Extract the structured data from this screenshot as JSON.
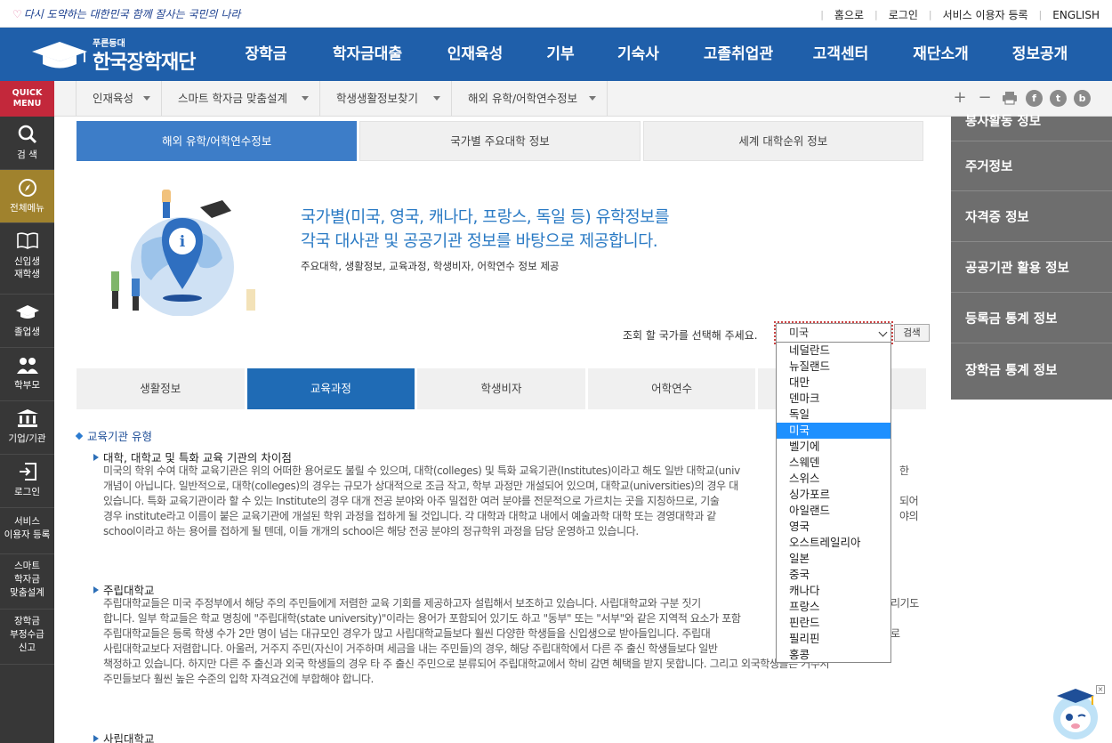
{
  "topbar": {
    "slogan": "다시 도약하는 대한민국 함께 잘사는 국민의 나라",
    "links": [
      "홈으로",
      "로그인",
      "서비스 이용자 등록",
      "ENGLISH"
    ]
  },
  "header": {
    "logo_small": "푸른등대",
    "logo_text": "한국장학재단",
    "nav": [
      "장학금",
      "학자금대출",
      "인재육성",
      "기부",
      "기숙사",
      "고졸취업관",
      "고객센터",
      "재단소개",
      "정보공개"
    ]
  },
  "quick": {
    "title_line1": "QUICK",
    "title_line2": "MENU",
    "items": [
      {
        "icon": "search-icon",
        "label1": "검 색",
        "label2": ""
      },
      {
        "icon": "compass-icon",
        "label1": "전체메뉴",
        "label2": ""
      },
      {
        "icon": "book-icon",
        "label1": "신입생",
        "label2": "재학생"
      },
      {
        "icon": "graduation-cap-icon",
        "label1": "졸업생",
        "label2": ""
      },
      {
        "icon": "parents-icon",
        "label1": "학부모",
        "label2": ""
      },
      {
        "icon": "building-icon",
        "label1": "기업/기관",
        "label2": ""
      },
      {
        "icon": "login-icon",
        "label1": "로그인",
        "label2": ""
      },
      {
        "icon": "",
        "label1": "서비스",
        "label2": "이용자 등록"
      },
      {
        "icon": "",
        "label1": "스마트",
        "label2": "학자금",
        "label3": "맞춤설계"
      },
      {
        "icon": "",
        "label1": "장학금",
        "label2": "부정수급",
        "label3": "신고"
      }
    ]
  },
  "subnav": {
    "items": [
      "인재육성",
      "스마트 학자금 맞춤설계",
      "학생생활정보찾기",
      "해외 유학/어학연수정보"
    ],
    "tools": {
      "zoom_in": "+",
      "zoom_out": "−",
      "facebook": "f",
      "twitter": "t",
      "blog": "b"
    }
  },
  "rside": {
    "items": [
      "봉사활동 정보",
      "주거정보",
      "자격증 정보",
      "공공기관 활용 정보",
      "등록금 통계 정보",
      "장학금 통계 정보"
    ]
  },
  "tabs1": [
    "해외 유학/어학연수정보",
    "국가별 주요대학 정보",
    "세계 대학순위 정보"
  ],
  "hero": {
    "line1": "국가별(미국, 영국, 캐나다, 프랑스, 독일 등) 유학정보를",
    "line2": "각국 대사관 및 공공기관 정보를 바탕으로 제공합니다.",
    "sub": "주요대학, 생활정보, 교육과정, 학생비자, 어학연수 정보 제공"
  },
  "country_select": {
    "label": "조회 할 국가를 선택해 주세요.",
    "selected": "미국",
    "button": "검색",
    "options": [
      "네덜란드",
      "뉴질랜드",
      "대만",
      "덴마크",
      "독일",
      "미국",
      "벨기에",
      "스웨덴",
      "스위스",
      "싱가포르",
      "아일랜드",
      "영국",
      "오스트레일리아",
      "일본",
      "중국",
      "캐나다",
      "프랑스",
      "핀란드",
      "필리핀",
      "홍콩"
    ],
    "highlighted": "미국"
  },
  "tabs2": [
    "생활정보",
    "교육과정",
    "학생비자",
    "어학연수",
    ""
  ],
  "content": {
    "section": "교육기관 유형",
    "h1": "대학, 대학교 및 특화 교육 기관의 차이점",
    "p1": [
      "미국의 학위 수여 대학 교육기관은 위의 어떠한 용어로도 불릴 수 있으며, 대학(colleges) 및 특화 교육기관(Institutes)이라고 해도 일반 대학교(univ",
      "개념이 아닙니다. 일반적으로, 대학(colleges)의 경우는 규모가 상대적으로 조금 작고, 학부 과정만 개설되어 있으며, 대학교(universities)의 경우 대",
      "있습니다. 특화 교육기관이라 할 수 있는 Institute의 경우 대개 전공 분야와 아주 밀접한 여러 분야를 전문적으로 가르치는 곳을 지칭하므로, 기술",
      "경우 institute라고 이름이 붙은 교육기관에 개설된 학위 과정을 접하게 될 것입니다. 각 대학과 대학교 내에서 예술과학 대학 또는 경영대학과 같",
      "school이라고 하는 용어를 접하게 될 텐데, 이들 개개의 school은 해당 전공 분야의 정규학위 과정을 담당 운영하고 있습니다."
    ],
    "p1_tail": [
      "한",
      "되어",
      "야의"
    ],
    "h2": "주립대학교",
    "p2": [
      "주립대학교들은 미국 주정부에서 해당 주의 주민들에게 저렴한 교육 기회를 제공하고자 설립해서 보조하고 있습니다. 사립대학교와 구분 짓기 ",
      "합니다. 일부 학교들은 학교 명칭에 \"주립대학(state university)\"이라는 용어가 포함되어 있기도 하고 \"동부\" 또는 \"서부\"와 같은 지역적 요소가 포함",
      "주립대학교들은 등록 학생 수가 2만 명이 넘는 대규모인 경우가 많고 사립대학교들보다 훨씬 다양한 학생들을 신입생으로 받아들입니다. 주립대",
      "사립대학교보다 저렴합니다. 아울러, 거주지 주민(자신이 거주하며 세금을 내는 주민들)의 경우, 해당 주립대학에서 다른 주 출신 학생들보다 일반",
      "책정하고 있습니다. 하지만 다른 주 출신과 외국 학생들의 경우 타 주 출신 주민으로 분류되어 주립대학교에서 학비 감면 혜택을 받지 못합니다. 그리고 외국학생들은 거주지",
      "주민들보다 훨씬 높은 수준의 입학 자격요건에 부합해야 합니다."
    ],
    "p2_tail": [
      "리기도",
      "로"
    ],
    "h3": "사립대학교"
  }
}
